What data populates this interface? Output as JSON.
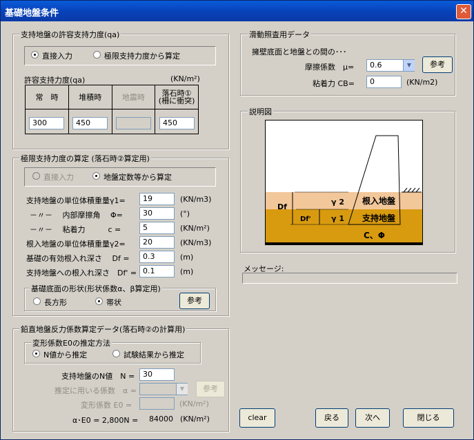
{
  "window": {
    "title": "基礎地盤条件",
    "close_glyph": "✕"
  },
  "bearing": {
    "legend": "支持地盤の許容支持力度(qa)",
    "radio_direct": "直接入力",
    "radio_limit": "極限支持力度から算定",
    "capacity_label": "許容支持力度(qa)",
    "capacity_unit": "(KN/m²)",
    "headers": [
      "常　時",
      "堆積時",
      "地震時",
      "落石時①",
      "(柵に衝突)"
    ],
    "values": [
      "300",
      "450",
      "",
      "450"
    ]
  },
  "limit": {
    "legend": "極限支持力度の算定 (落石時②算定用)",
    "radio_direct": "直接入力",
    "radio_coef": "地盤定数等から算定",
    "rows": [
      {
        "label": "支持地盤の単位体積重量γ1=",
        "value": "19",
        "unit": "(KN/m3)"
      },
      {
        "label": "－〃－　 内部摩擦角　 Φ=",
        "value": "30",
        "unit": "(°)"
      },
      {
        "label": "－〃－　 粘着力　　　c =",
        "value": "5",
        "unit": "(KN/m²)"
      },
      {
        "label": "根入地盤の単位体積重量γ2=",
        "value": "20",
        "unit": "(KN/m3)"
      },
      {
        "label": "基礎の有効根入れ深さ　 Df =",
        "value": "0.3",
        "unit": "(m)"
      },
      {
        "label": "支持地盤への根入れ深さ　Df' =",
        "value": "0.1",
        "unit": "(m)"
      }
    ],
    "shape_legend": "基礎底面の形状(形状係数α、β算定用)",
    "shape_rect": "長方形",
    "shape_strip": "帯状",
    "ref_button": "参考"
  },
  "vertical": {
    "legend": "鉛直地盤反力係数算定データ(落石時②の計算用)",
    "method_legend": "変形係数E0の推定方法",
    "radio_n": "N値から推定",
    "radio_test": "試験結果から推定",
    "n_label": "支持地盤のN値　N =",
    "n_value": "30",
    "coef_label": "推定に用いる係数　α =",
    "coef_value": "",
    "ref_button": "参考",
    "e0_label": "変形係数 E0 =",
    "e0_value": "",
    "e0_unit": "(KN/m²)",
    "result_label": "α･E0 = 2,800N =",
    "result_value": "84000",
    "result_unit": "(KN/m²)"
  },
  "sliding": {
    "legend": "滑動照査用データ",
    "subtitle": "擁壁底面と地盤との間の･･･",
    "friction_label": "摩擦係数　μ=",
    "friction_value": "0.6",
    "ref_button": "参考",
    "cohesion_label": "粘着力 CB=",
    "cohesion_value": "0",
    "cohesion_unit": "(KN/m2)"
  },
  "diagram": {
    "legend": "説明図",
    "df": "Df",
    "dfp": "Df'",
    "g2": "γ 2",
    "g1": "γ 1",
    "embed_ground": "根入地盤",
    "support_ground": "支持地盤",
    "c_phi": "C、Φ",
    "colors": {
      "upper": "#f2c79a",
      "lower": "#d89b10"
    }
  },
  "message": {
    "label": "メッセージ:",
    "text": ""
  },
  "buttons": {
    "clear": "clear",
    "back": "戻る",
    "next": "次へ",
    "close": "閉じる"
  }
}
